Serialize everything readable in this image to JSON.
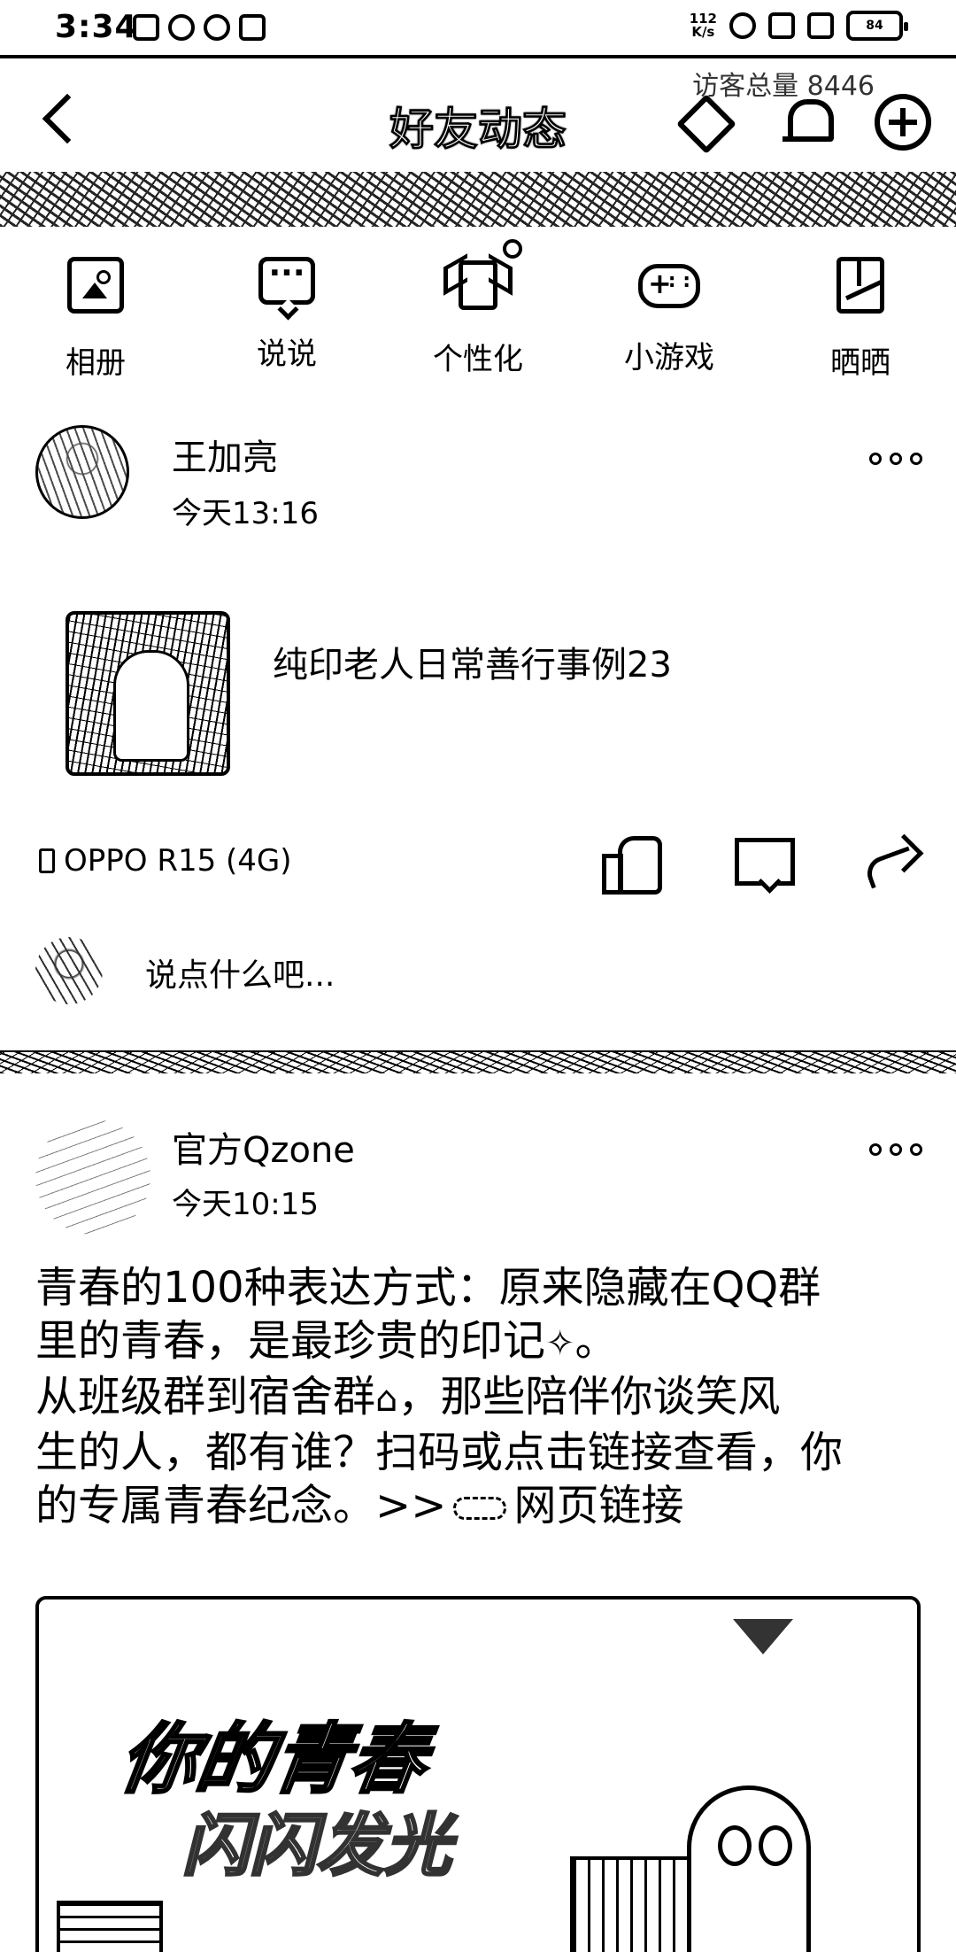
{
  "status_bar": {
    "time": "3:34",
    "net_speed_top": "112",
    "net_speed_unit": "K/s",
    "battery": "84"
  },
  "header": {
    "title": "好友动态",
    "visits_text": "访客总量 8446",
    "back_icon": "chevron-left-icon",
    "icons": [
      "diamond-icon",
      "bell-icon",
      "add-icon"
    ]
  },
  "quick_nav": [
    {
      "label": "相册",
      "icon": "album-icon"
    },
    {
      "label": "说说",
      "icon": "chat-icon"
    },
    {
      "label": "个性化",
      "icon": "shirt-icon"
    },
    {
      "label": "小游戏",
      "icon": "gamepad-icon"
    },
    {
      "label": "晒晒",
      "icon": "show-icon"
    }
  ],
  "post1": {
    "author": "王加亮",
    "time": "今天13:16",
    "shared_title": "纯印老人日常善行事例23",
    "device": "OPPO R15 (4G)",
    "comment_placeholder": "说点什么吧..."
  },
  "post2": {
    "author": "官方Qzone",
    "time": "今天10:15",
    "line1": "青春的100种表达方式：原来隐藏在QQ群",
    "line2": "里的青春，是最珍贵的印记",
    "line2_end": "。",
    "line3a": "从班级群到宿舍群",
    "line3b": "，那些陪伴你谈笑风",
    "line4": "生的人，都有谁？扫码或点击链接查看，你",
    "line5a": "的专属青春纪念。>>",
    "link_text": "网页链接",
    "banner_line1": "你的青春",
    "banner_line2": "闪闪发光"
  }
}
